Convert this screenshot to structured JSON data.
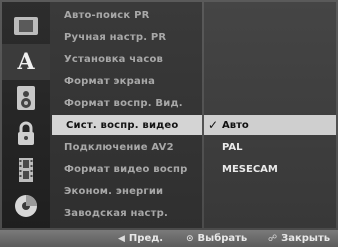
{
  "left_icons": [
    {
      "name": "disc-settings-icon"
    },
    {
      "name": "language-icon",
      "glyph": "A"
    },
    {
      "name": "audio-speaker-icon"
    },
    {
      "name": "lock-icon"
    },
    {
      "name": "film-strip-icon"
    },
    {
      "name": "record-disc-icon"
    }
  ],
  "menu": {
    "items": [
      {
        "label": "Авто-поиск PR"
      },
      {
        "label": "Ручная настр. PR"
      },
      {
        "label": "Установка часов"
      },
      {
        "label": "Формат экрана"
      },
      {
        "label": "Формат воспр. Вид."
      },
      {
        "label": "Сист. воспр. видео"
      },
      {
        "label": "Подключение AV2"
      },
      {
        "label": "Формат видео воспр"
      },
      {
        "label": "Эконом. энергии"
      },
      {
        "label": "Заводская настр."
      }
    ],
    "selected_index": 5
  },
  "options": {
    "items": [
      {
        "label": "Авто",
        "checked": true
      },
      {
        "label": "PAL",
        "checked": false
      },
      {
        "label": "MESECAM",
        "checked": false
      }
    ],
    "check_glyph": "✓"
  },
  "bottom": {
    "prev": {
      "glyph": "◀",
      "label": "Пред."
    },
    "select": {
      "glyph": "⊙",
      "label": "Выбрать"
    },
    "close": {
      "glyph": "☍",
      "label": "Закрыть"
    }
  },
  "colors": {
    "selected_bg": "#d4d4d4",
    "menu_text": "#a8a8a8"
  }
}
